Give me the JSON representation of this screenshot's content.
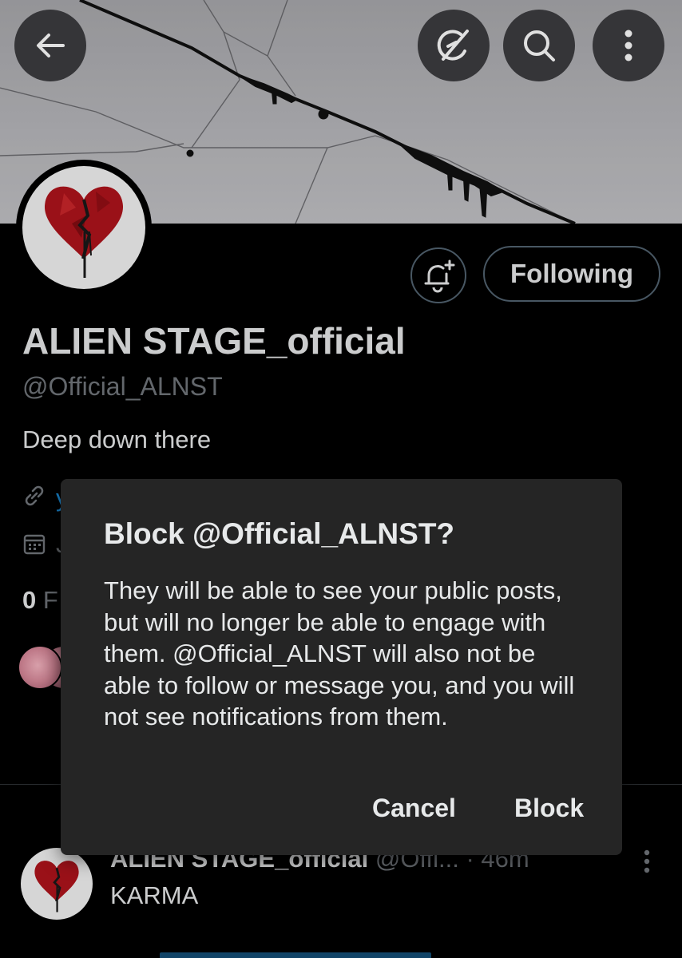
{
  "header": {
    "back_icon": "arrow-left-icon",
    "grok_icon": "grok-slash-icon",
    "search_icon": "search-icon",
    "more_icon": "more-vertical-icon"
  },
  "profile": {
    "display_name": "ALIEN STAGE_official",
    "handle": "@Official_ALNST",
    "bio": "Deep down there",
    "following_label": "Following",
    "link_partial": "y",
    "joined_partial": "J",
    "following_count_partial": "0",
    "following_label_partial": "F"
  },
  "tweet": {
    "author_name": "ALIEN STAGE_official",
    "author_handle": "@Offi...",
    "time": "· 46m",
    "text": "KARMA"
  },
  "dialog": {
    "title": "Block @Official_ALNST?",
    "body": "They will be able to see your public posts, but will no longer be able to engage with them. @Official_ALNST will also not be able to follow or message you, and you will not see notifications from them.",
    "cancel_label": "Cancel",
    "block_label": "Block"
  },
  "colors": {
    "background": "#000000",
    "dialog": "#252525",
    "text_primary": "#e7e9ea",
    "text_secondary": "#71767b",
    "border": "#536471",
    "accent_link": "#1d9bf0"
  }
}
